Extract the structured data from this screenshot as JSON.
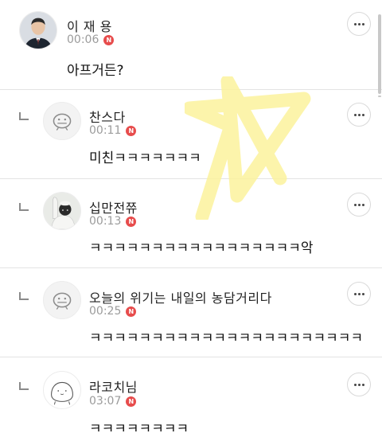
{
  "comments": [
    {
      "nickname": "이 재 용",
      "time": "00:06",
      "badge": "N",
      "text": "아프거든?",
      "avatar": "person-photo-avatar",
      "is_reply": false
    },
    {
      "nickname": "찬스다",
      "time": "00:11",
      "badge": "N",
      "text": "미친ㅋㅋㅋㅋㅋㅋㅋ",
      "avatar": "default-mascot-avatar",
      "is_reply": true
    },
    {
      "nickname": "십만전쮸",
      "time": "00:13",
      "badge": "N",
      "text": "ㅋㅋㅋㅋㅋㅋㅋㅋㅋㅋㅋㅋㅋㅋㅋㅋㅋ악",
      "avatar": "raised-arm-photo-avatar",
      "is_reply": true
    },
    {
      "nickname": "오늘의 위기는 내일의 농담거리다",
      "time": "00:25",
      "badge": "N",
      "text": "ㅋㅋㅋㅋㅋㅋㅋㅋㅋㅋㅋㅋㅋㅋㅋㅋㅋㅋㅋㅋㅋㅋ",
      "avatar": "default-mascot-avatar",
      "is_reply": true
    },
    {
      "nickname": "라코치님",
      "time": "03:07",
      "badge": "N",
      "text": "ㅋㅋㅋㅋㅋㅋㅋㅋ",
      "avatar": "drawn-face-avatar",
      "is_reply": true
    }
  ],
  "icons": {
    "more": "more-options-icon",
    "reply": "reply-arrow-icon",
    "new": "new-badge-icon"
  },
  "colors": {
    "badge": "#e74c4c",
    "time": "#9b9b9b",
    "divider": "#e3e3e3",
    "star_overlay": "#fbf29c"
  }
}
